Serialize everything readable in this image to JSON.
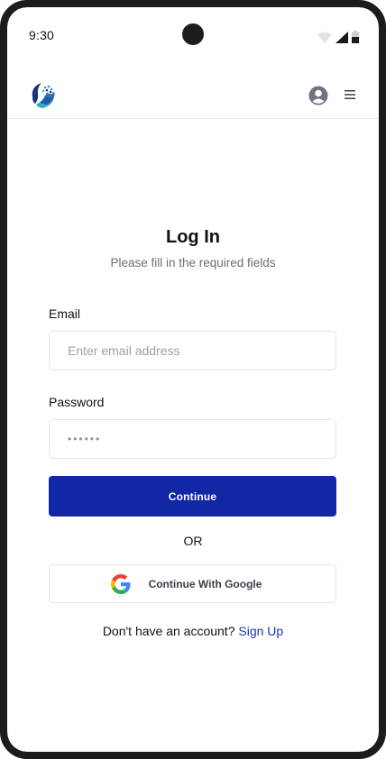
{
  "status_bar": {
    "time": "9:30"
  },
  "header": {
    "logo_icon": "brand-logo-icon",
    "account_icon": "user-avatar-icon",
    "menu_icon": "hamburger-menu-icon"
  },
  "login": {
    "title": "Log In",
    "subtitle": "Please fill in the required fields",
    "email_label": "Email",
    "email_placeholder": "Enter email address",
    "email_value": "",
    "password_label": "Password",
    "password_value": "••••••",
    "continue_label": "Continue",
    "or_label": "OR",
    "google_label": "Continue With Google",
    "no_account_text": "Don't have an account?",
    "signup_label": "Sign Up"
  },
  "colors": {
    "primary": "#1227a6",
    "link": "#1a36b8",
    "border": "#e3e5e9"
  }
}
